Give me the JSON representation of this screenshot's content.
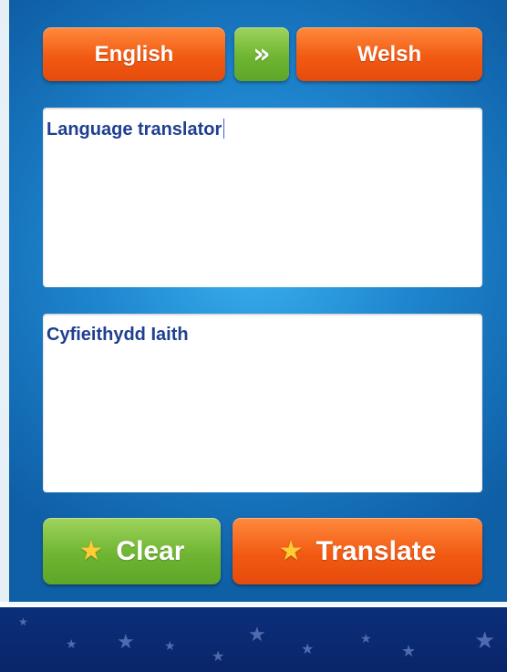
{
  "header": {
    "source_language": "English",
    "swap_icon": "»",
    "target_language": "Welsh"
  },
  "input": {
    "text": "Language translator"
  },
  "output": {
    "text": "Cyfieithydd Iaith"
  },
  "actions": {
    "clear_label": "Clear",
    "translate_label": "Translate",
    "star_icon": "★"
  },
  "colors": {
    "background_blue": "#1e86cf",
    "orange_button": "#f25a13",
    "green_button": "#6fb532",
    "footer_navy": "#0b2f7a",
    "text_navy": "#1f3f8f"
  }
}
